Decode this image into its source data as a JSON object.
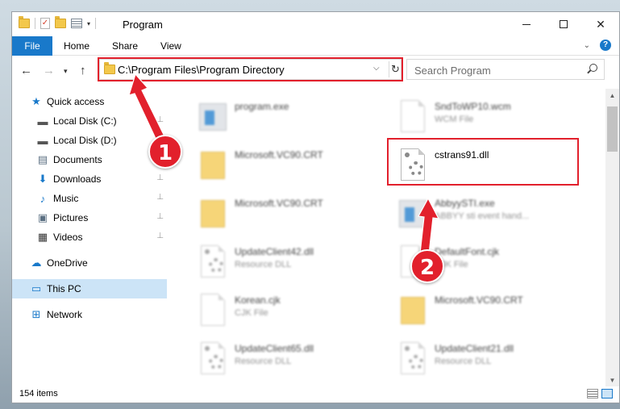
{
  "window": {
    "title": "Program",
    "controls": {
      "minimize": "",
      "maximize": "",
      "close": "✕"
    }
  },
  "ribbon": {
    "tabs": [
      "File",
      "Home",
      "Share",
      "View"
    ]
  },
  "address": {
    "path": "C:\\Program Files\\Program Directory",
    "dropdown": "⌵",
    "refresh": "↻"
  },
  "search": {
    "placeholder": "Search Program"
  },
  "sidebar": {
    "items": [
      {
        "label": "Quick access",
        "icon": "star-icon",
        "glyph": "★",
        "color": "#1979ca"
      },
      {
        "label": "Local Disk (C:)",
        "icon": "drive-icon",
        "glyph": "▬",
        "color": "#555555",
        "pinned": true
      },
      {
        "label": "Local Disk (D:)",
        "icon": "drive-icon",
        "glyph": "▬",
        "color": "#555555"
      },
      {
        "label": "Documents",
        "icon": "documents-icon",
        "glyph": "▤",
        "color": "#5b6f82",
        "pinned": true
      },
      {
        "label": "Downloads",
        "icon": "download-icon",
        "glyph": "⬇",
        "color": "#1979ca",
        "pinned": true
      },
      {
        "label": "Music",
        "icon": "music-icon",
        "glyph": "♪",
        "color": "#1979ca",
        "pinned": true
      },
      {
        "label": "Pictures",
        "icon": "pictures-icon",
        "glyph": "▣",
        "color": "#5b6f82",
        "pinned": true
      },
      {
        "label": "Videos",
        "icon": "videos-icon",
        "glyph": "▦",
        "color": "#333333",
        "pinned": true
      },
      {
        "label": "OneDrive",
        "icon": "cloud-icon",
        "glyph": "☁",
        "color": "#1979ca"
      },
      {
        "label": "This PC",
        "icon": "computer-icon",
        "glyph": "▭",
        "color": "#1979ca",
        "selected": true
      },
      {
        "label": "Network",
        "icon": "network-icon",
        "glyph": "⊞",
        "color": "#1979ca"
      }
    ],
    "pin_glyph": "📌"
  },
  "files": {
    "left": [
      {
        "name": "program.exe",
        "sub": "",
        "kind": "exe"
      },
      {
        "name": "Microsoft.VC90.CRT",
        "sub": "",
        "kind": "folder"
      },
      {
        "name": "Microsoft.VC90.CRT",
        "sub": "",
        "kind": "folder"
      },
      {
        "name": "UpdateClient42.dll",
        "sub": "Resource DLL",
        "kind": "dll"
      },
      {
        "name": "Korean.cjk",
        "sub": "CJK File",
        "kind": "page"
      },
      {
        "name": "UpdateClient65.dll",
        "sub": "Resource DLL",
        "kind": "dll"
      }
    ],
    "right": [
      {
        "name": "SndToWP10.wcm",
        "sub": "WCM File",
        "kind": "page"
      },
      {
        "name": "cstrans91.dll",
        "sub": "",
        "kind": "dll",
        "focus": true
      },
      {
        "name": "AbbyySTI.exe",
        "sub": "ABBYY sti event hand...",
        "kind": "exe"
      },
      {
        "name": "DefaultFont.cjk",
        "sub": "CJK File",
        "kind": "page"
      },
      {
        "name": "Microsoft.VC90.CRT",
        "sub": "",
        "kind": "folder"
      },
      {
        "name": "UpdateClient21.dll",
        "sub": "Resource DLL",
        "kind": "dll"
      }
    ]
  },
  "status": {
    "count": "154 items"
  },
  "annotations": {
    "step1": "1",
    "step2": "2",
    "accent": "#e2202c"
  }
}
